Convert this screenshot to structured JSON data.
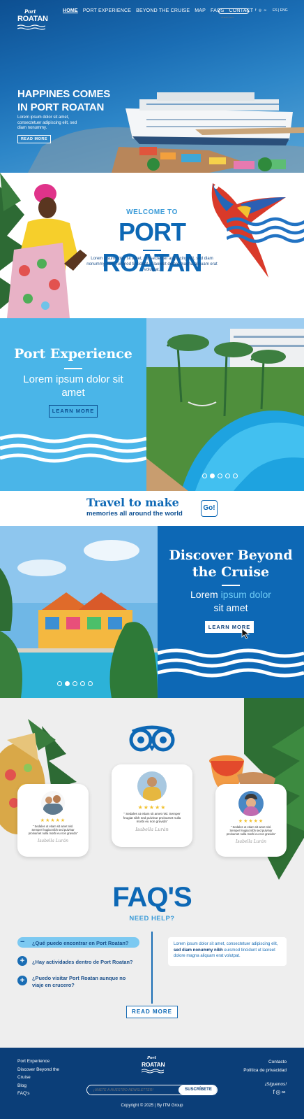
{
  "header": {
    "logo_top": "Port",
    "logo_main": "ROATAN",
    "nav": [
      "HOME",
      "PORT EXPERIENCE",
      "BEYOND THE CRUISE",
      "MAP",
      "FAQS",
      "CONTACT"
    ],
    "search_placeholder": "search here",
    "lang": "ES | ENG"
  },
  "hero": {
    "title_line1": "HAPPINES COMES",
    "title_line2": "IN PORT ROATAN",
    "text": "Lorem ipsum dolor sit amet, consectetuer adipiscing elit, sed diam nonummy.",
    "button": "READ MORE"
  },
  "welcome": {
    "kicker": "WELCOME TO",
    "title": "PORT ROATAN",
    "text": "Lorem ipsum dolor sit amet, consectetuer adipiscing elit, sed diam nonummy nibh euismod tincidunt ut laoreet dolore magna aliquam erat volutpat."
  },
  "port_experience": {
    "title": "Port Experience",
    "subtitle": "Lorem ipsum dolor sit amet",
    "button": "LEARN MORE",
    "slides": 5,
    "active_slide": 2
  },
  "travel": {
    "line1": "Travel to make",
    "line2": "memories all around the world",
    "go": "Go!"
  },
  "discover": {
    "title_line1": "Discover Beyond",
    "title_line2": "the Cruise",
    "sub_a": "Lorem ",
    "sub_b": "ipsum dolor",
    "sub_c": "sit amet",
    "button": "LEARN MORE",
    "slides": 5,
    "active_slide": 2
  },
  "reviews": [
    {
      "quote": "\" Sedales ut etiam sit amet nisl. Semper feugiat nibh sed pulvinar proinamet nulla morbi eu non gravida\"",
      "signature": "Isabella Lurán",
      "stars": 5
    },
    {
      "quote": "\" Sedales ut etiam sit amet nisl. Semper feugiat nibh sed pulvinar proinamet nulla morbi eu non gravida\"",
      "signature": "Isabella Lurán",
      "stars": 5
    },
    {
      "quote": "\" Sedales ut etiam sit amet nisl. Semper feugiat nibh sed pulvinar proinamet nulla morbi eu non gravida\"",
      "signature": "Isabella Lurán",
      "stars": 5
    }
  ],
  "faq": {
    "title": "FAQ'S",
    "subtitle": "NEED HELP?",
    "questions": [
      "¿Qué puedo encontrar en Port Roatan?",
      "¿Hay actividades dentro de Port Roatan?",
      "¿Puedo visitar Port Roatan aunque no viaje en crucero?"
    ],
    "answer_a": "Lorem ipsum dolor sit amet, consectetuer adipiscing elit, ",
    "answer_b": "sed diam nonummy nibh",
    "answer_c": " euismod tincidunt ut laoreet dolore magna aliquam erat volutpat.",
    "button": "READ MORE"
  },
  "footer": {
    "links": [
      "Port Experience",
      "Discover Beyond the",
      "Cruise",
      "Blog",
      "FAQ's"
    ],
    "right_links": [
      "Contacto",
      "Política de privacidad"
    ],
    "social_label": "¡Síguenos!",
    "newsletter_placeholder": "¡ÚNETE A NUESTRO NEWSLETTER!",
    "subscribe": "SUSCRÍBETE",
    "copyright": "Copyright © 2025  |  By ITM Group"
  },
  "colors": {
    "primary": "#0d68b5",
    "light_blue": "#4ab5e8",
    "dark_navy": "#0b3e78"
  }
}
